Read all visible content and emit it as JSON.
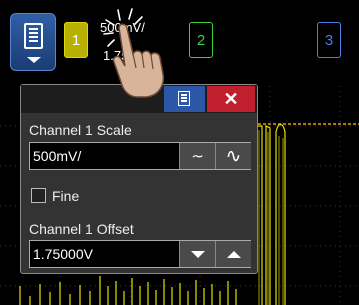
{
  "topbar": {
    "channels": [
      {
        "label": "1",
        "color": "#e0d800"
      },
      {
        "label": "2",
        "color": "#3ad13a"
      },
      {
        "label": "3",
        "color": "#4d7be8"
      }
    ],
    "ch1_scale_text": "500mV/",
    "ch1_offset_text": "1.75"
  },
  "dialog": {
    "scale_label": "Channel 1 Scale",
    "scale_value": "500mV/",
    "fine_label": "Fine",
    "fine_checked": false,
    "offset_label": "Channel 1 Offset",
    "offset_value": "1.75000V",
    "close_symbol": "✕"
  },
  "colors": {
    "trace": "#e6e000",
    "menu_button": "#2f5fa8",
    "close_button": "#c0202e"
  }
}
